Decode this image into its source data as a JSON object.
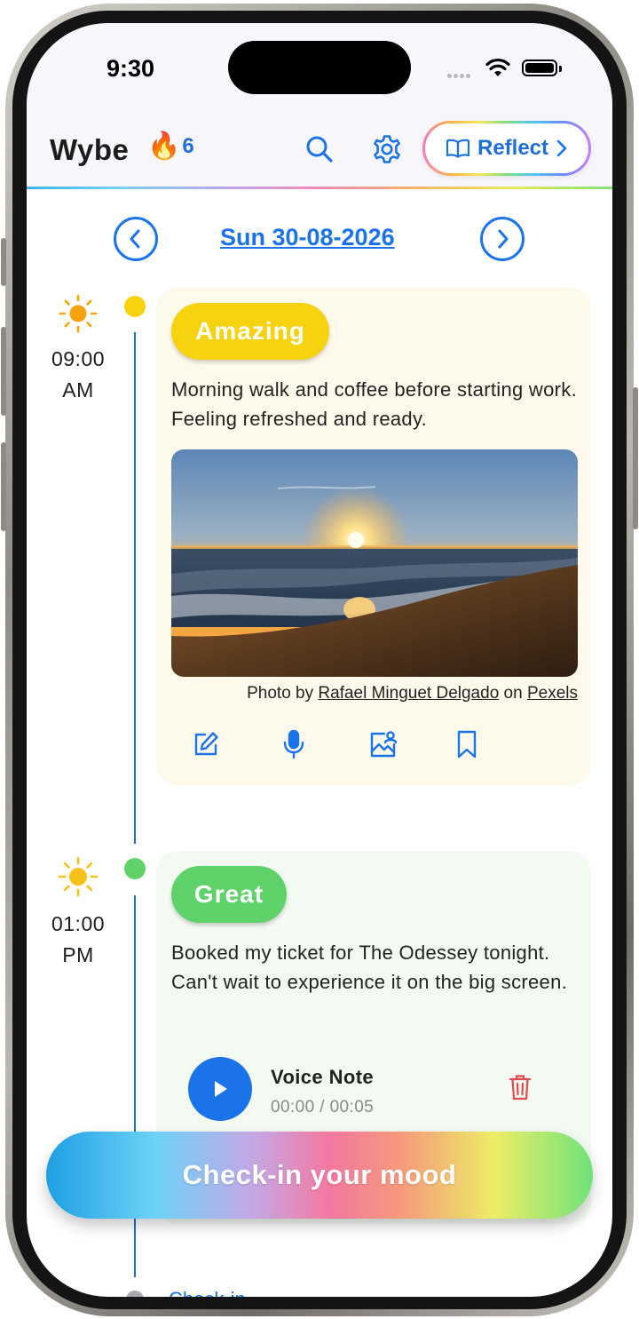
{
  "status_bar": {
    "time": "9:30"
  },
  "header": {
    "app_title": "Wybe",
    "streak_icon": "fire-icon",
    "streak_count": "6",
    "search_icon": "search-icon",
    "settings_icon": "gear-icon",
    "reflect_label": "Reflect"
  },
  "date_nav": {
    "date": "Sun 30-08-2026"
  },
  "entries": [
    {
      "time_line1": "09:00",
      "time_line2": "AM",
      "mood": "Amazing",
      "mood_color": "#f7d20e",
      "dot_color": "#f7d20e",
      "card_color": "#fefaeb",
      "text": "Morning walk and coffee before starting work. Feeling refreshed and ready.",
      "photo_credit": {
        "prefix": "Photo by ",
        "author": "Rafael Minguet Delgado",
        "middle": " on ",
        "source": "Pexels"
      },
      "actions": [
        "edit-icon",
        "microphone-icon",
        "add-photo-icon",
        "bookmark-icon"
      ]
    },
    {
      "time_line1": "01:00",
      "time_line2": "PM",
      "mood": "Great",
      "mood_color": "#5fd36a",
      "dot_color": "#5fd36a",
      "card_color": "#f3faf2",
      "text": "Booked my ticket for The Odessey tonight. Can't wait to experience it on the big screen.",
      "voice_note": {
        "title": "Voice Note",
        "time": "00:00 / 00:05"
      }
    }
  ],
  "peek_entry": {
    "label": "Check-in"
  },
  "checkin_button": {
    "label": "Check-in your mood"
  },
  "colors": {
    "accent": "#1a73e8",
    "timeline": "#1d6fd0"
  }
}
